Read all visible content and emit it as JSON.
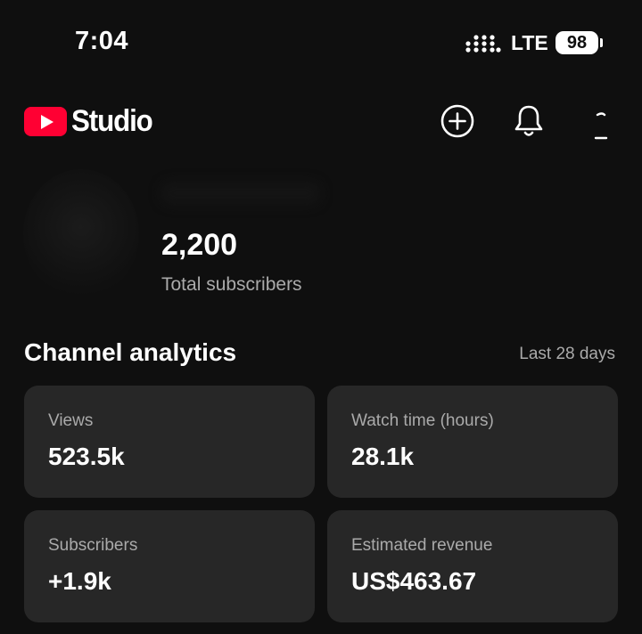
{
  "status_bar": {
    "time": "7:04",
    "network": "LTE",
    "battery": "98"
  },
  "header": {
    "logo_text": "Studio",
    "icons": [
      "create-icon",
      "notifications-icon",
      "account-icon"
    ]
  },
  "channel": {
    "subscriber_count": "2,200",
    "subscriber_label": "Total subscribers"
  },
  "analytics": {
    "title": "Channel analytics",
    "period": "Last 28 days",
    "cards": [
      {
        "label": "Views",
        "value": "523.5k"
      },
      {
        "label": "Watch time (hours)",
        "value": "28.1k"
      },
      {
        "label": "Subscribers",
        "value": "+1.9k"
      },
      {
        "label": "Estimated revenue",
        "value": "US$463.67"
      }
    ]
  },
  "colors": {
    "background": "#0f0f0f",
    "card": "#272727",
    "brand_red": "#ff0033",
    "secondary_text": "#aaaaaa"
  }
}
